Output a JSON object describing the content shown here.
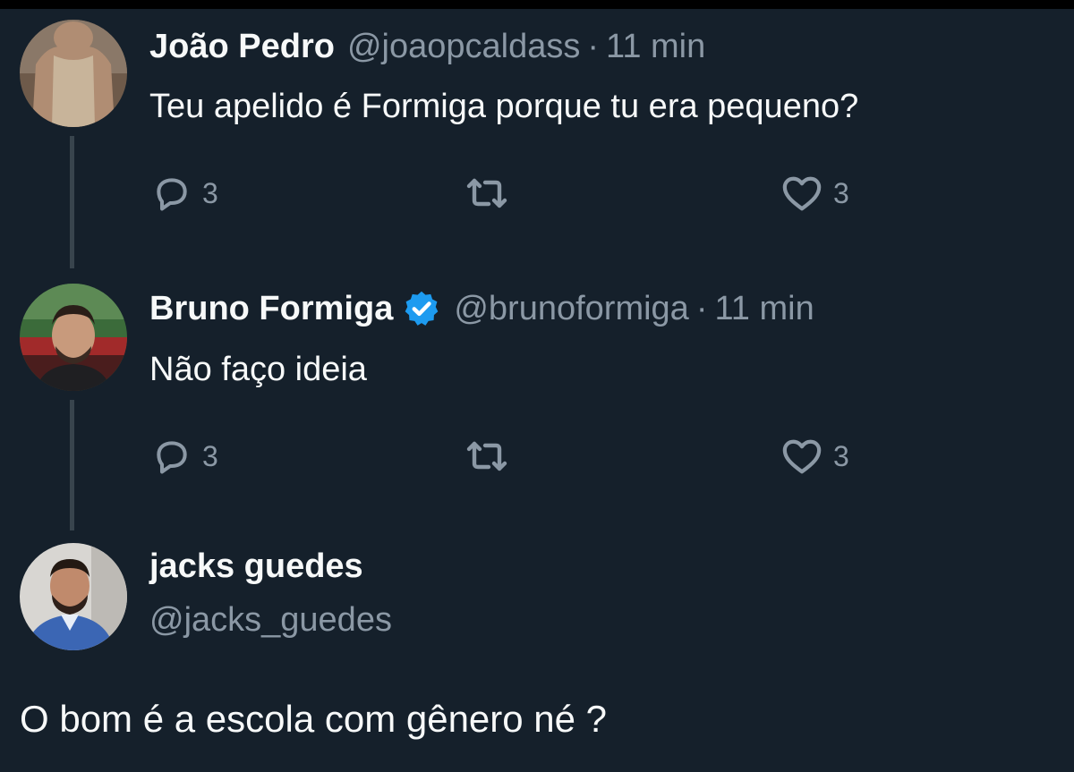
{
  "tweets": [
    {
      "name": "João Pedro",
      "handle": "@joaopcaldass",
      "separator": "·",
      "time": "11 min",
      "text": "Teu apelido é Formiga porque tu era pequeno?",
      "verified": false,
      "reply_count": "3",
      "like_count": "3"
    },
    {
      "name": "Bruno Formiga",
      "handle": "@brunoformiga",
      "separator": "·",
      "time": "11 min",
      "text": "Não faço ideia",
      "verified": true,
      "reply_count": "3",
      "like_count": "3"
    }
  ],
  "reply": {
    "name": "jacks guedes",
    "handle": "@jacks_guedes",
    "text": "O bom é a escola com gênero né ?"
  },
  "icons": {
    "reply": "reply-icon",
    "retweet": "retweet-icon",
    "like": "heart-icon",
    "verified": "verified-badge-icon"
  },
  "colors": {
    "background": "#15202b",
    "text": "#f7f9f9",
    "muted": "#8b98a5",
    "verified": "#1d9bf0",
    "thread_line": "#38444d"
  }
}
